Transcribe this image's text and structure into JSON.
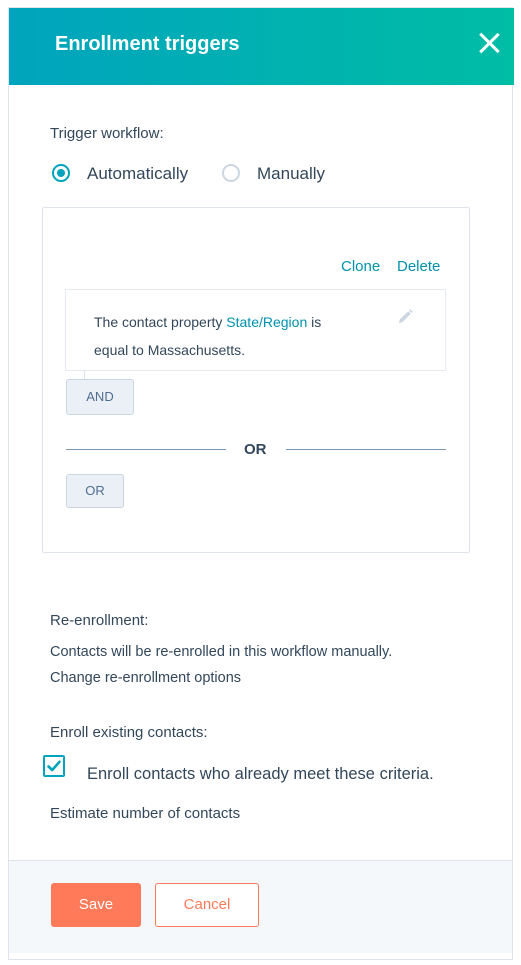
{
  "header": {
    "title": "Enrollment triggers"
  },
  "trigger": {
    "label": "Trigger workflow:",
    "options": [
      {
        "label": "Automatically",
        "selected": true
      },
      {
        "label": "Manually",
        "selected": false
      }
    ]
  },
  "filter_group": {
    "clone_label": "Clone",
    "delete_label": "Delete",
    "filter": {
      "prefix": "The contact property",
      "property": "State/Region",
      "verb": "is",
      "operator": "equal to",
      "value": "Massachusetts."
    },
    "and_label": "AND",
    "or_divider": "OR",
    "or_label": "OR"
  },
  "reenrollment": {
    "title": "Re-enrollment:",
    "description": "Contacts will be re-enrolled in this workflow manually.",
    "link": "Change re-enrollment options"
  },
  "existing": {
    "title": "Enroll existing contacts:",
    "checkbox_label": "Enroll contacts who already meet these criteria.",
    "checked": true,
    "link": "Estimate number of contacts"
  },
  "footer": {
    "save_label": "Save",
    "cancel_label": "Cancel"
  },
  "colors": {
    "header_gradient_start": "#00a4bd",
    "header_gradient_end": "#00bda5",
    "link": "#0091ae",
    "primary_button": "#ff7a59"
  }
}
